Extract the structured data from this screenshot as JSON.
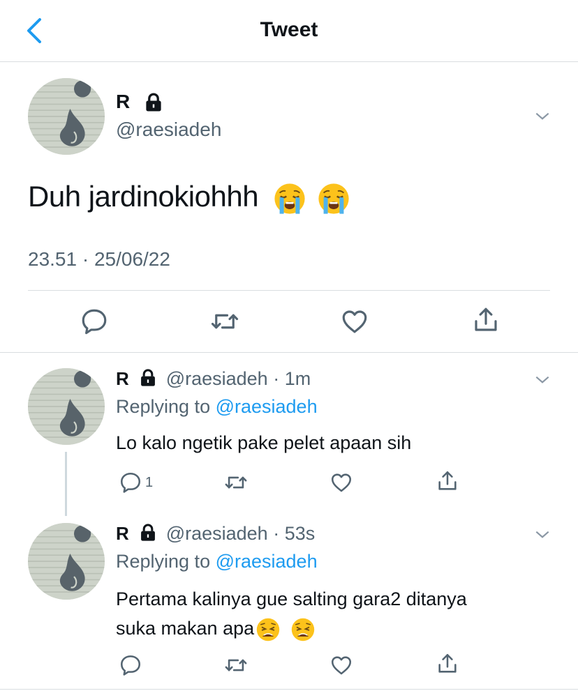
{
  "header": {
    "title": "Tweet",
    "back_icon": "chevron-left-icon"
  },
  "colors": {
    "accent": "#1d9bf0",
    "text": "#0f1419",
    "secondary": "#536471",
    "divider": "#d9dde0"
  },
  "main_tweet": {
    "name": "R",
    "handle": "@raesiadeh",
    "text": "Duh jardinokiohhh",
    "emojis": [
      "loudly-crying-face-emoji",
      "loudly-crying-face-emoji"
    ],
    "timestamp": "23.51 · 25/06/22"
  },
  "replies": [
    {
      "name": "R",
      "handle": "@raesiadeh",
      "time": "1m",
      "replying_prefix": "Replying to ",
      "replying_to": "@raesiadeh",
      "text": "Lo kalo ngetik pake pelet apaan sih",
      "reply_count": "1"
    },
    {
      "name": "R",
      "handle": "@raesiadeh",
      "time": "53s",
      "replying_prefix": "Replying to ",
      "replying_to": "@raesiadeh",
      "text_line1": "Pertama kalinya gue salting gara2 ditanya",
      "text_line2": "suka makan apa",
      "emojis": [
        "weary-face-emoji",
        "weary-face-emoji"
      ]
    }
  ]
}
